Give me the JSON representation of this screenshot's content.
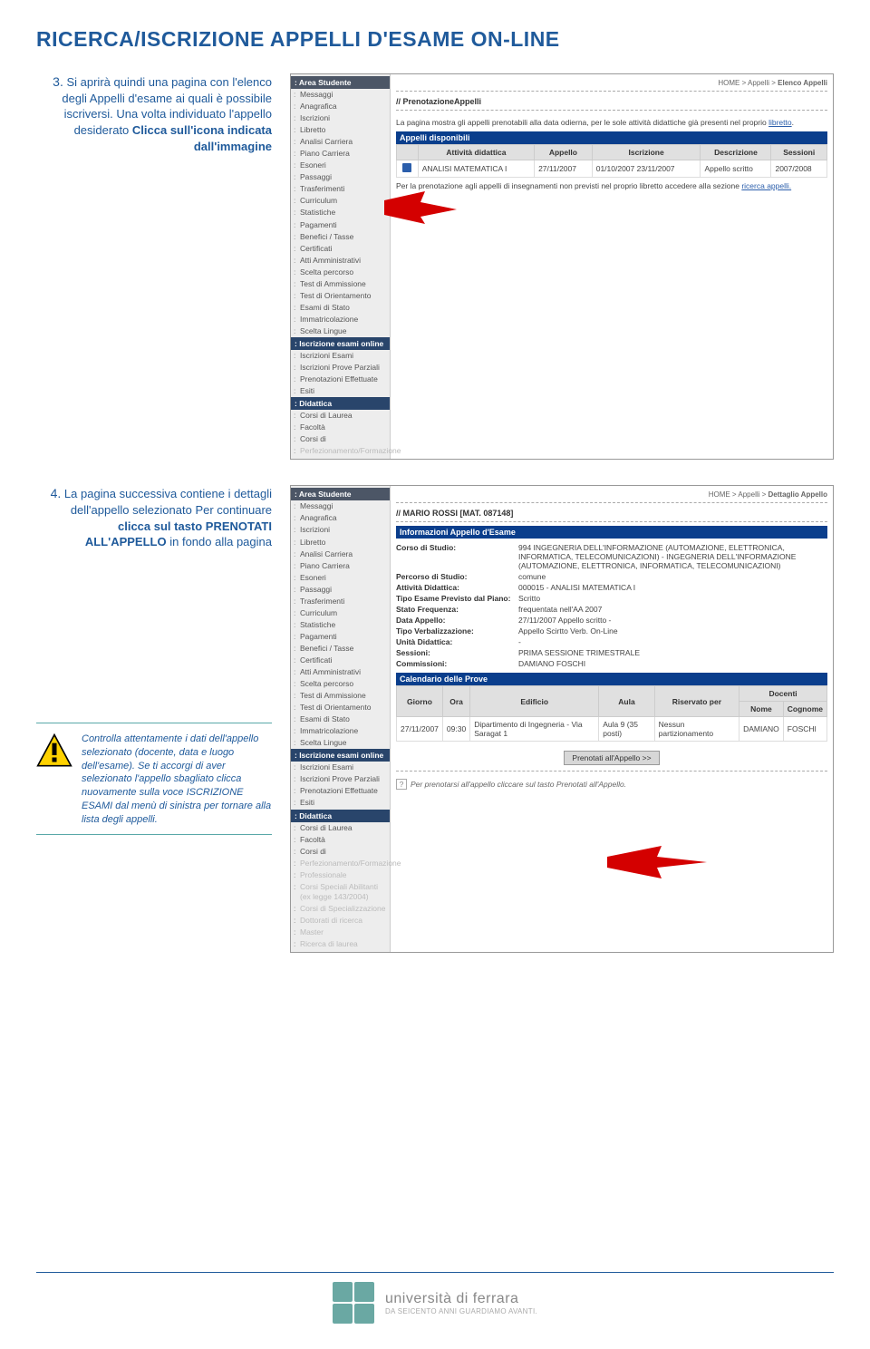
{
  "title": "RICERCA/ISCRIZIONE APPELLI D'ESAME ON-LINE",
  "step3": {
    "num": "3.",
    "text_a": "Si aprirà quindi una pagina con l'elenco degli Appelli d'esame ai quali è possibile iscriversi. Una volta individuato l'appello desiderato ",
    "text_b": "Clicca sull'icona indicata dall'immagine"
  },
  "step4": {
    "num": "4.",
    "text_a": "La pagina successiva contiene i dettagli dell'appello selezionato Per continuare ",
    "text_b": "clicca sul tasto PRENOTATI ALL'APPELLO",
    "text_c": " in fondo alla pagina"
  },
  "warn": {
    "a": "Controlla attentamente i dati dell'appello selezionato (docente, data e luogo dell'esame). Se ti accorgi di aver selezionato l'appello sbagliato clicca nuovamente sulla voce ISCRIZIONE ESAMI dal menù di sinistra per tornare alla lista degli appelli."
  },
  "nav": {
    "hdr_area": ": Area Studente",
    "items1": [
      "Messaggi",
      "Anagrafica",
      "Iscrizioni",
      "Libretto",
      "Analisi Carriera",
      "Piano Carriera",
      "Esoneri",
      "Passaggi",
      "Trasferimenti",
      "Curriculum",
      "Statistiche",
      "Pagamenti",
      "Benefici / Tasse",
      "Certificati",
      "Atti Amministrativi",
      "Scelta percorso",
      "Test di Ammissione",
      "Test di Orientamento",
      "Esami di Stato",
      "Immatricolazione",
      "Scelta Lingue"
    ],
    "hdr_iscr": ": Iscrizione esami online",
    "items2": [
      "Iscrizioni Esami",
      "Iscrizioni Prove Parziali",
      "Prenotazioni Effettuate",
      "Esiti"
    ],
    "hdr_did": ": Didattica",
    "items3": [
      "Corsi di Laurea",
      "Facoltà",
      "Corsi di"
    ],
    "items3b": [
      "Perfezionamento/Formazione",
      "Professionale",
      "Corsi Speciali Abilitanti (ex legge 143/2004)",
      "Corsi di Specializzazione",
      "Dottorati di ricerca",
      "Master",
      "Ricerca di laurea"
    ],
    "fade_last": "Perfezionamento/Formazione"
  },
  "shot1": {
    "breadcrumb_a": "HOME > Appelli > ",
    "breadcrumb_b": "Elenco Appelli",
    "heading": "// PrenotazioneAppelli",
    "intro_a": "La pagina mostra gli appelli prenotabili alla data odierna, per le sole attività didattiche già presenti nel proprio ",
    "intro_link1": "libretto",
    "bar": "Appelli disponibili",
    "th": [
      "",
      "Attività didattica",
      "Appello",
      "Iscrizione",
      "Descrizione",
      "Sessioni"
    ],
    "row": [
      "",
      "ANALISI MATEMATICA I",
      "27/11/2007",
      "01/10/2007 23/11/2007",
      "Appello scritto",
      "2007/2008"
    ],
    "after_a": "Per la prenotazione agli appelli di insegnamenti non previsti nel proprio libretto accedere alla sezione ",
    "after_link": "ricerca appelli."
  },
  "shot2": {
    "breadcrumb_a": "HOME > Appelli > ",
    "breadcrumb_b": "Dettaglio Appello",
    "heading": "// MARIO ROSSI [MAT. 087148]",
    "bar1": "Informazioni Appello d'Esame",
    "kv": [
      [
        "Corso di Studio:",
        "994 INGEGNERIA DELL'INFORMAZIONE (AUTOMAZIONE, ELETTRONICA, INFORMATICA, TELECOMUNICAZIONI) - INGEGNERIA DELL'INFORMAZIONE (AUTOMAZIONE, ELETTRONICA, INFORMATICA, TELECOMUNICAZIONI)"
      ],
      [
        "Percorso di Studio:",
        "comune"
      ],
      [
        "Attività Didattica:",
        "000015 - ANALISI MATEMATICA I"
      ],
      [
        "Tipo Esame Previsto dal Piano:",
        "Scritto"
      ],
      [
        "Stato Frequenza:",
        "frequentata nell'AA 2007"
      ],
      [
        "Data Appello:",
        "27/11/2007 Appello scritto -"
      ],
      [
        "Tipo Verbalizzazione:",
        "Appello Scirtto Verb. On-Line"
      ],
      [
        "Unità Didattica:",
        "-"
      ],
      [
        "Sessioni:",
        "PRIMA SESSIONE TRIMESTRALE"
      ],
      [
        "Commissioni:",
        "DAMIANO FOSCHI"
      ]
    ],
    "bar2": "Calendario delle Prove",
    "th2": [
      "Giorno",
      "Ora",
      "Edificio",
      "Aula",
      "Riservato per",
      "Docenti"
    ],
    "th2sub": [
      "",
      "",
      "",
      "",
      "",
      "Nome",
      "Cognome"
    ],
    "row2": [
      "27/11/2007",
      "09:30",
      "Dipartimento di Ingegneria - Via Saragat 1",
      "Aula 9 (35 posti)",
      "Nessun partizionamento",
      "DAMIANO",
      "FOSCHI"
    ],
    "btn": "Prenotati all'Appello >>",
    "footnote": "Per prenotarsi all'appello cliccare sul tasto Prenotati all'Appello."
  },
  "footer": {
    "l1": "università di ferrara",
    "l2": "DA SEICENTO ANNI GUARDIAMO AVANTI."
  }
}
